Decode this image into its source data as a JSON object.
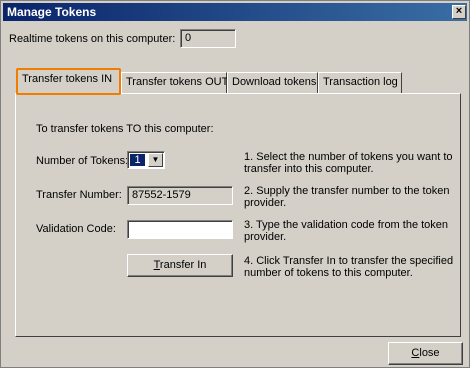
{
  "window": {
    "title": "Manage Tokens",
    "close_glyph": "×"
  },
  "realtime": {
    "label": "Realtime tokens on this computer:",
    "value": "0"
  },
  "tabs": [
    {
      "label": "Transfer tokens IN"
    },
    {
      "label": "Transfer tokens OUT"
    },
    {
      "label": "Download tokens"
    },
    {
      "label": "Transaction log"
    }
  ],
  "panel": {
    "intro": "To transfer tokens TO this computer:",
    "number_label": "Number of Tokens:",
    "number_value": "1",
    "dropdown_glyph": "▼",
    "transfer_number_label": "Transfer Number:",
    "transfer_number_value": "87552-1579",
    "validation_label": "Validation Code:",
    "validation_value": "",
    "transfer_button_accel": "T",
    "transfer_button_rest": "ransfer In",
    "steps": [
      "1.  Select the number of tokens you want to transfer into this computer.",
      "2.  Supply the transfer number to the token provider.",
      "3.  Type the validation code from the token provider.",
      "4.  Click Transfer In to transfer the specified number of tokens to this computer."
    ]
  },
  "footer": {
    "close_accel": "C",
    "close_rest": "lose"
  }
}
